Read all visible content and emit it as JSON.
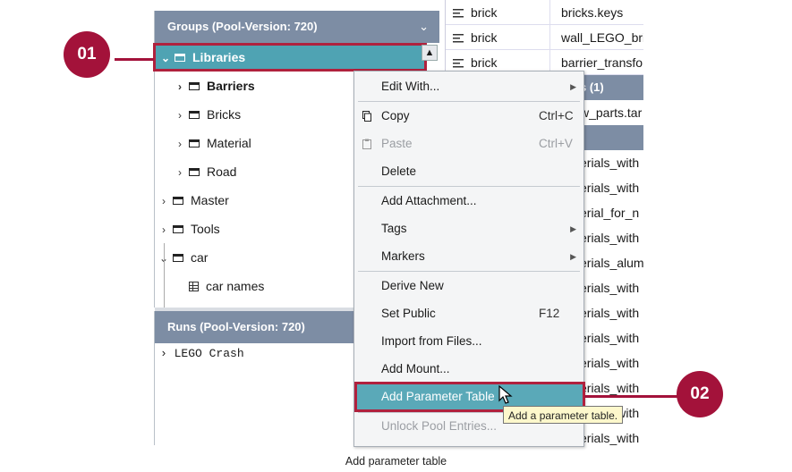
{
  "groups_panel": {
    "title": "Groups (Pool-Version: 720)",
    "collapse_icon": "chevron-down-icon",
    "tree": [
      {
        "label": "Libraries",
        "expanded": true,
        "icon": "folder-icon",
        "selected": true
      },
      {
        "label": "Barriers",
        "expanded": false,
        "icon": "folder-icon",
        "bold": true
      },
      {
        "label": "Bricks",
        "expanded": false,
        "icon": "folder-icon"
      },
      {
        "label": "Material",
        "expanded": false,
        "icon": "folder-icon"
      },
      {
        "label": "Road",
        "expanded": false,
        "icon": "folder-icon"
      },
      {
        "label": "Master",
        "expanded": false,
        "icon": "folder-icon"
      },
      {
        "label": "Tools",
        "expanded": false,
        "icon": "folder-icon"
      },
      {
        "label": "car",
        "expanded": true,
        "icon": "folder-icon"
      },
      {
        "label": "car names",
        "icon": "table-icon"
      }
    ]
  },
  "runs_panel": {
    "title": "Runs (Pool-Version: 720)",
    "items": [
      {
        "label": "LEGO Crash",
        "expanded": false
      }
    ]
  },
  "table": {
    "rows": [
      {
        "type": "brick",
        "name": "bricks.keys"
      },
      {
        "type": "brick",
        "name": "wall_LEGO_bric"
      },
      {
        "type": "brick",
        "name": "barrier_transfo"
      }
    ],
    "band1": "s (1)",
    "frag1": "w_parts.tar",
    "band2": ")",
    "fragments": [
      "erials_with",
      "erials_with",
      "erial_for_n",
      "erials_with",
      "erials_alum",
      "erials_with",
      "erials_with",
      "erials_with",
      "erials_with",
      "erials_with",
      "erials_with",
      "erials_with"
    ]
  },
  "context_menu": {
    "items": [
      {
        "label": "Edit With...",
        "submenu": true
      },
      {
        "label": "Copy",
        "shortcut": "Ctrl+C",
        "icon": "copy-icon"
      },
      {
        "label": "Paste",
        "shortcut": "Ctrl+V",
        "icon": "paste-icon",
        "disabled": true
      },
      {
        "label": "Delete"
      },
      {
        "label": "Add Attachment..."
      },
      {
        "label": "Tags",
        "submenu": true
      },
      {
        "label": "Markers",
        "submenu": true
      },
      {
        "label": "Derive New"
      },
      {
        "label": "Set Public",
        "shortcut": "F12"
      },
      {
        "label": "Import from Files..."
      },
      {
        "label": "Add Mount..."
      },
      {
        "label": "Add Parameter Table",
        "highlighted": true
      },
      {
        "label": "Unlock Pool Entries...",
        "disabled": true
      }
    ],
    "tooltip": "Add a parameter table."
  },
  "callouts": {
    "first": "01",
    "second": "02"
  },
  "colors": {
    "header": "#7d8da4",
    "selection": "#4fa3b3",
    "callout": "#a3123a"
  },
  "caption": "Add parameter table"
}
